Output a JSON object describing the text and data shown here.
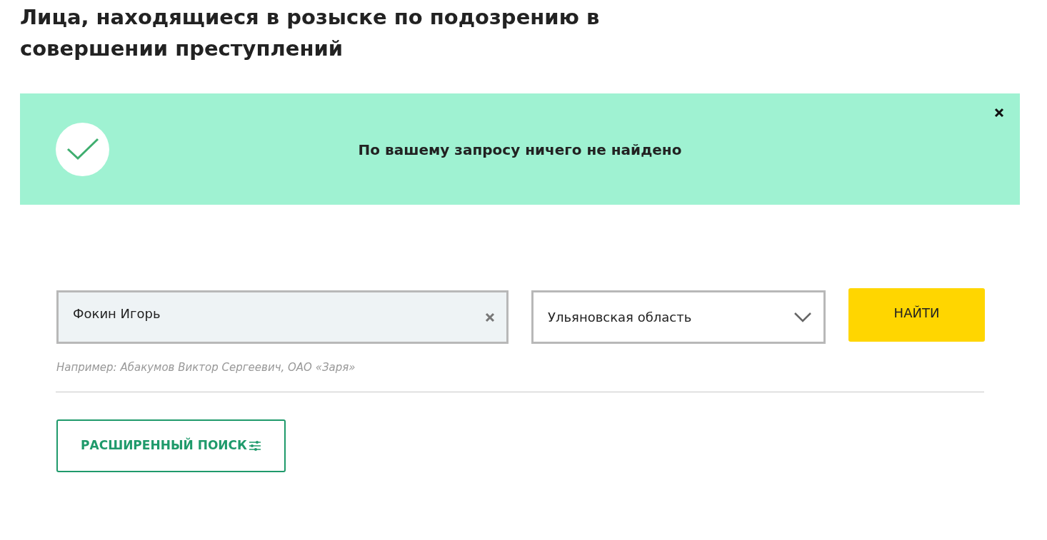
{
  "title": "Лица, находящиеся в розыске по подозрению в совершении преступлений",
  "alert": {
    "message": "По вашему запросу ничего не найдено"
  },
  "search": {
    "value": "Фокин Игорь",
    "hint": "Например: Абакумов Виктор Сергеевич, ОАО «Заря»"
  },
  "region": {
    "value": "Ульяновская область"
  },
  "submit": {
    "label": "НАЙТИ"
  },
  "advanced": {
    "label": "РАСШИРЕННЫЙ ПОИСК"
  }
}
